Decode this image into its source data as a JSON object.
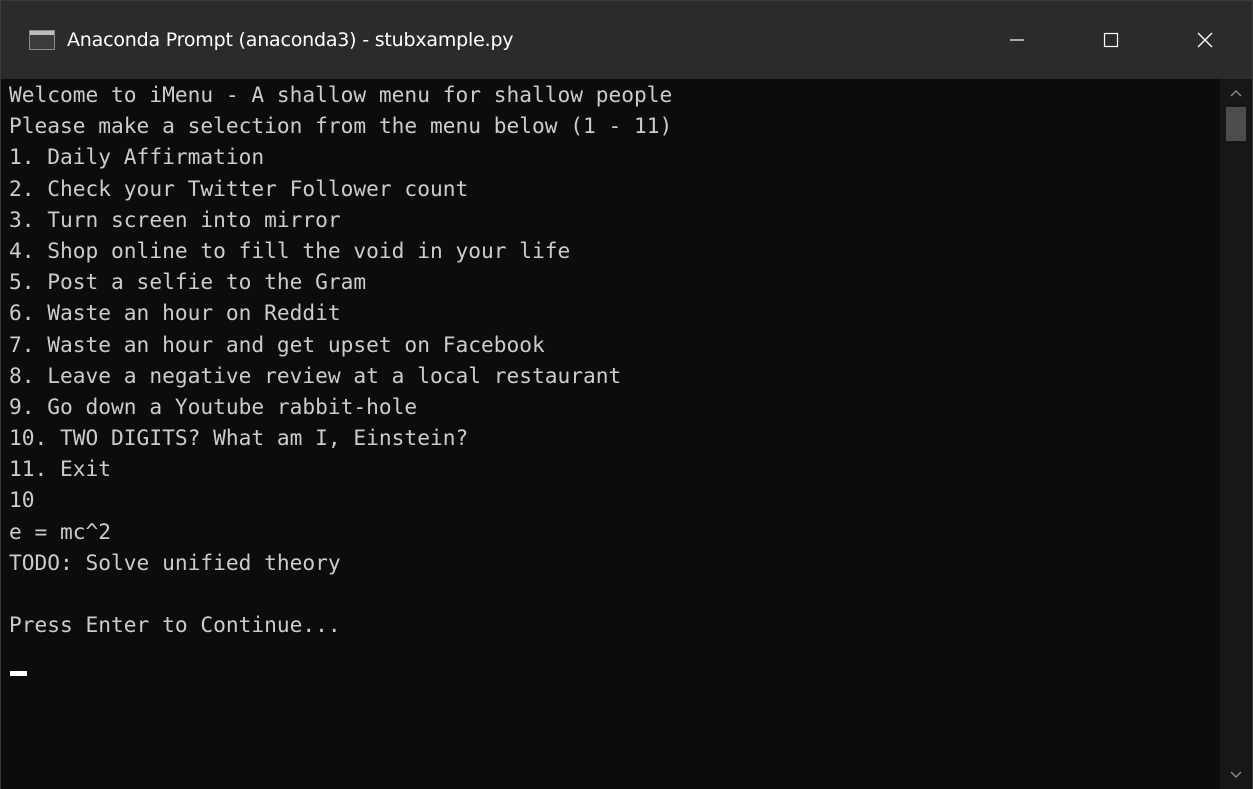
{
  "window": {
    "title": "Anaconda Prompt (anaconda3) - stubxample.py",
    "icon": "console-icon"
  },
  "caption_buttons": {
    "minimize": "minimize-icon",
    "maximize": "maximize-icon",
    "close": "close-icon"
  },
  "console": {
    "lines": [
      "Welcome to iMenu - A shallow menu for shallow people",
      "Please make a selection from the menu below (1 - 11)",
      "1. Daily Affirmation",
      "2. Check your Twitter Follower count",
      "3. Turn screen into mirror",
      "4. Shop online to fill the void in your life",
      "5. Post a selfie to the Gram",
      "6. Waste an hour on Reddit",
      "7. Waste an hour and get upset on Facebook",
      "8. Leave a negative review at a local restaurant",
      "9. Go down a Youtube rabbit-hole",
      "10. TWO DIGITS? What am I, Einstein?",
      "11. Exit",
      "10",
      "e = mc^2",
      "TODO: Solve unified theory",
      "",
      "Press Enter to Continue..."
    ]
  },
  "colors": {
    "background": "#0c0c0c",
    "text": "#cccccc",
    "titlebar": "#2b2b2b",
    "title_text": "#ffffff"
  },
  "scrollbar": {
    "up": "scroll-up-arrow-icon",
    "down": "scroll-down-arrow-icon"
  }
}
